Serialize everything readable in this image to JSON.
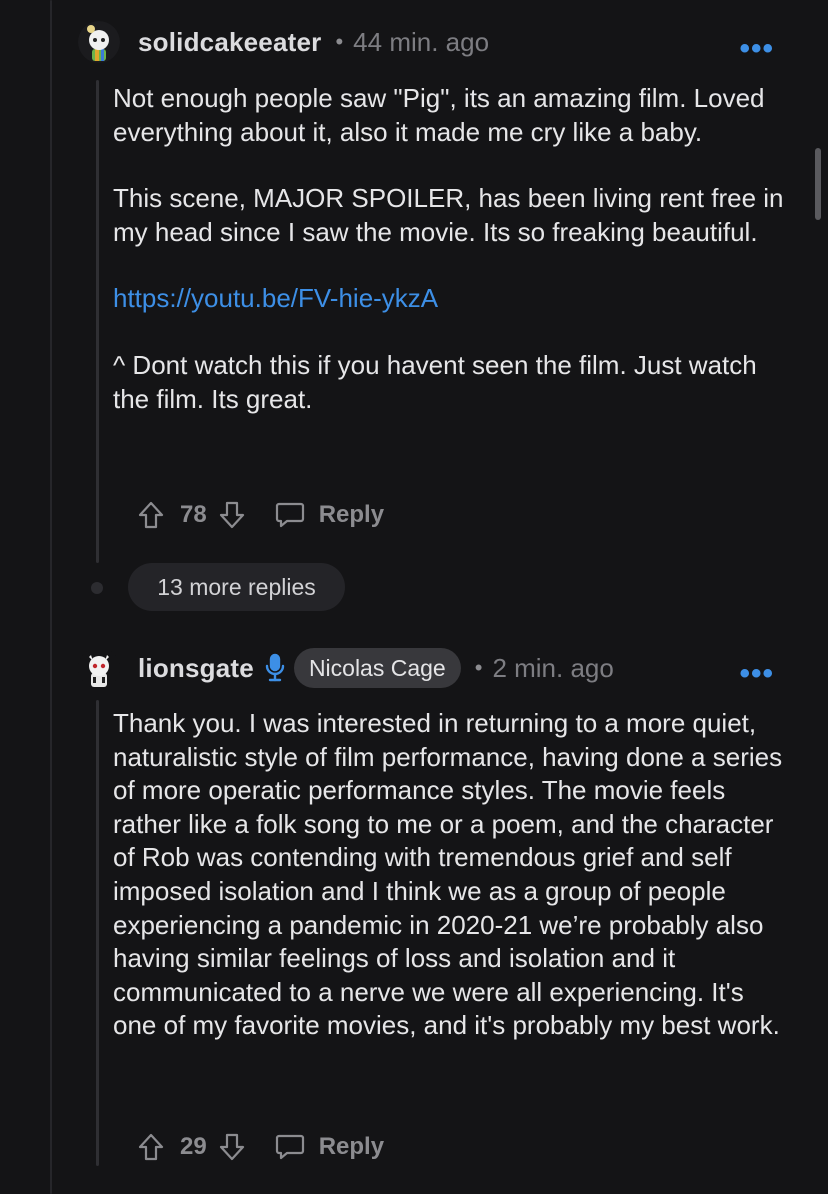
{
  "comments": [
    {
      "username": "solidcakeeater",
      "time": "44 min. ago",
      "paragraphs": [
        "Not enough people saw \"Pig\", its an amazing film. Loved everything about it, also it made me cry like a baby.",
        "This scene, MAJOR SPOILER, has been living rent free in my head since I saw the movie. Its so freaking beautiful.",
        "https://youtu.be/FV-hie-ykzA",
        "^ Dont watch this if you havent seen the film. Just watch the film. Its great."
      ],
      "votes": "78",
      "reply_label": "Reply"
    },
    {
      "username": "lionsgate",
      "flair": "Nicolas Cage",
      "time": "2 min. ago",
      "paragraphs": [
        "Thank you. I was interested in returning to a more quiet, naturalistic style of film performance, having done a series of more operatic performance styles. The movie feels rather like a folk song to me or a poem, and the character of Rob was contending with tremendous grief and self imposed isolation and I think we as a group of people experiencing a pandemic in 2020-21 we’re probably also having similar feelings of loss and isolation and it communicated to a nerve we were all experiencing. It's one of my favorite movies, and it's probably my best work."
      ],
      "votes": "29",
      "reply_label": "Reply"
    }
  ],
  "more_replies": "13 more replies",
  "more_menu_glyph": "•••",
  "separator": "•",
  "icons": {
    "upvote": "upvote-arrow-icon",
    "downvote": "downvote-arrow-icon",
    "reply": "speech-bubble-icon",
    "mic": "microphone-icon"
  },
  "colors": {
    "background": "#141416",
    "link": "#3d8fe6",
    "muted": "#8c8c90"
  }
}
